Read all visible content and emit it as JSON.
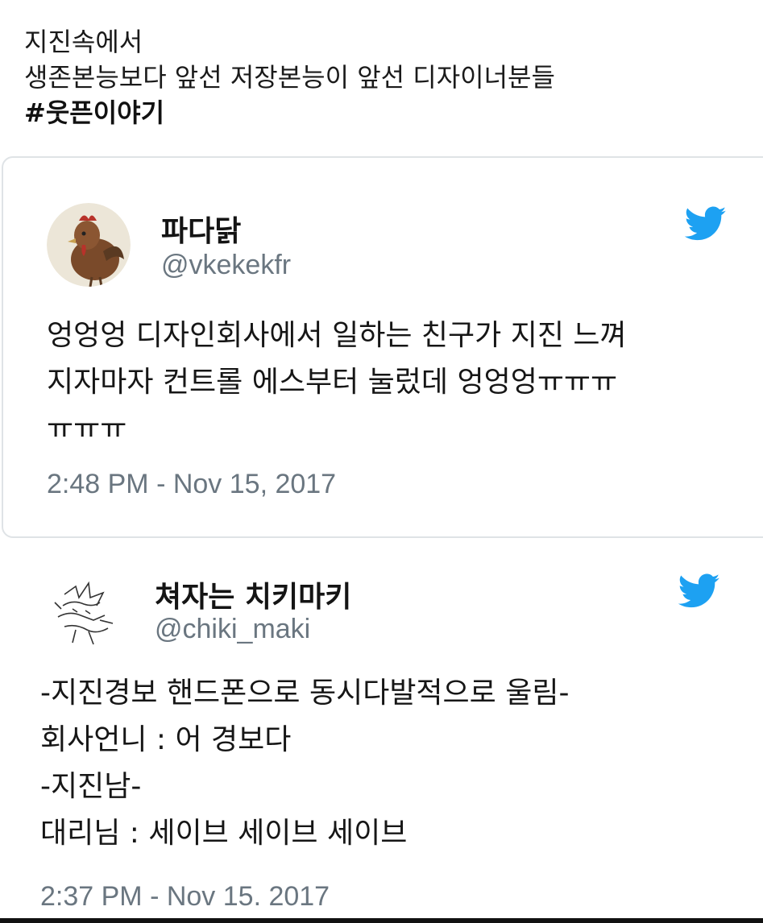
{
  "post": {
    "lines": [
      "지진속에서",
      "생존본능보다 앞선 저장본능이 앞선 디자이너분들"
    ],
    "hashtag": "#웃픈이야기"
  },
  "tweets": [
    {
      "display_name": "파다닭",
      "handle": "@vkekekfr",
      "avatar_icon": "rooster-painting-avatar",
      "platform_icon": "twitter-bird-icon",
      "body_lines": [
        "엉엉엉 디자인회사에서 일하는 친구가 지진 느껴",
        "지자마자 컨트롤 에스부터 눌렀데 엉엉엉ㅠㅠㅠ",
        "ㅠㅠㅠ"
      ],
      "timestamp": "2:48 PM - Nov 15, 2017"
    },
    {
      "display_name": "쳐자는 치키마키",
      "handle": "@chiki_maki",
      "avatar_icon": "sketch-character-avatar",
      "platform_icon": "twitter-bird-icon",
      "body_lines": [
        "-지진경보 핸드폰으로 동시다발적으로 울림-",
        "회사언니 : 어 경보다",
        "-지진남-",
        "대리님 : 세이브 세이브 세이브"
      ],
      "timestamp": "2:37 PM - Nov 15. 2017"
    }
  ],
  "colors": {
    "twitter_blue": "#1da1f2",
    "secondary_text": "#6a7680",
    "card_border": "#dfe3e6"
  }
}
